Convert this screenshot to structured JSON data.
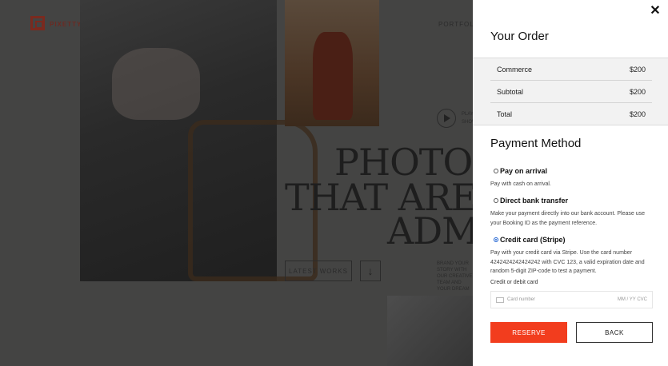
{
  "background": {
    "logo_text": "PIXETTY",
    "nav_link": "PORTFOLIO",
    "headline_lines": [
      "PHOTOS",
      "THAT ARE",
      "ADMI"
    ],
    "latest_works_label": "LATEST WORKS",
    "play_text": "PLAY SHOWREEL",
    "small_text": "BRAND YOUR STORY WITH OUR CREATIVE TEAM AND YOUR DREAM"
  },
  "panel": {
    "close_symbol": "✕",
    "title": "Your Order",
    "order_rows": [
      {
        "label": "Commerce",
        "value": "$200"
      },
      {
        "label": "Subtotal",
        "value": "$200"
      },
      {
        "label": "Total",
        "value": "$200"
      }
    ],
    "payment_title": "Payment Method",
    "methods": [
      {
        "label": "Pay on arrival",
        "desc": "Pay with cash on arrival.",
        "checked": false
      },
      {
        "label": "Direct bank transfer",
        "desc": "Make your payment directly into our bank account. Please use your Booking ID as the payment reference.",
        "checked": false
      },
      {
        "label": "Credit card (Stripe)",
        "desc": "Pay with your credit card via Stripe. Use the card number 4242424242424242 with CVC 123, a valid expiration date and random 5-digit ZIP-code to test a payment.",
        "checked": true
      }
    ],
    "card_label": "Credit or debit card",
    "card_placeholder": "Card number",
    "card_right_placeholder": "MM / YY  CVC",
    "reserve_label": "RESERVE",
    "back_label": "BACK",
    "colors": {
      "accent": "#f23d1e",
      "overlay": "#444443"
    }
  }
}
